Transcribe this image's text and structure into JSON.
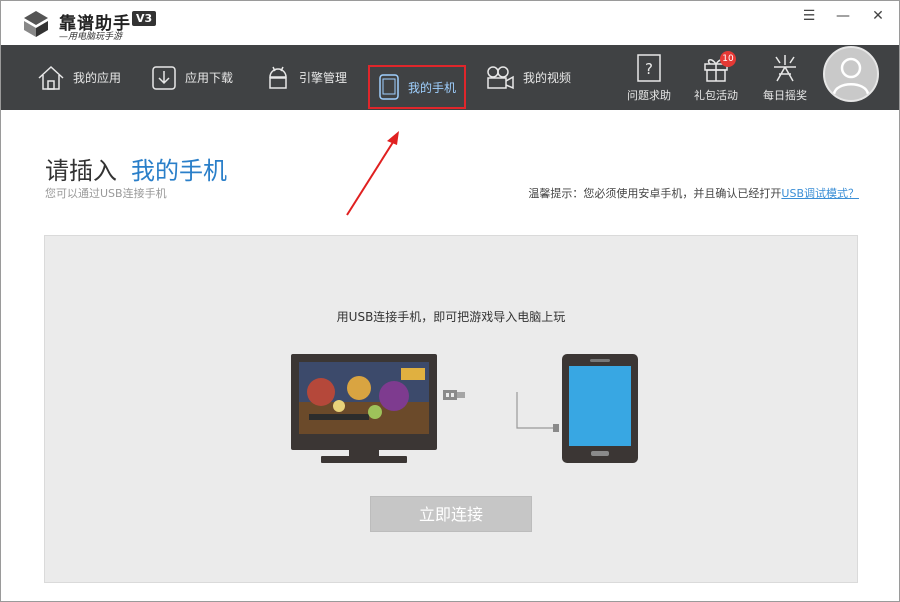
{
  "app": {
    "name": "靠谱助手",
    "version": "V3",
    "slogan": "—用电脑玩手游"
  },
  "window_controls": {
    "menu": "☰",
    "minimize": "—",
    "close": "✕"
  },
  "nav": {
    "items": [
      {
        "label": "我的应用",
        "icon": "house-icon"
      },
      {
        "label": "应用下载",
        "icon": "download-icon"
      },
      {
        "label": "引擎管理",
        "icon": "android-icon"
      },
      {
        "label": "我的手机",
        "icon": "phone-icon",
        "active": true
      },
      {
        "label": "我的视频",
        "icon": "video-camera-icon"
      }
    ],
    "right": [
      {
        "label": "问题求助",
        "icon": "help-icon"
      },
      {
        "label": "礼包活动",
        "icon": "gift-icon",
        "badge": "10"
      },
      {
        "label": "每日摇奖",
        "icon": "prize-icon"
      }
    ]
  },
  "content": {
    "heading_prefix": "请插入",
    "heading_highlight": "我的手机",
    "sub_text": "您可以通过USB连接手机",
    "tip_text": "温馨提示：您必须使用安卓手机，并且确认已经打开",
    "tip_link": "USB调试模式？",
    "panel_text": "用USB连接手机，即可把游戏导入电脑上玩",
    "connect_button": "立即连接"
  },
  "colors": {
    "nav_bg": "#404244",
    "accent_blue": "#2a7fc9",
    "highlight_red": "#e0262b",
    "phone_screen": "#38a7e3",
    "device_body": "#3b3634"
  }
}
